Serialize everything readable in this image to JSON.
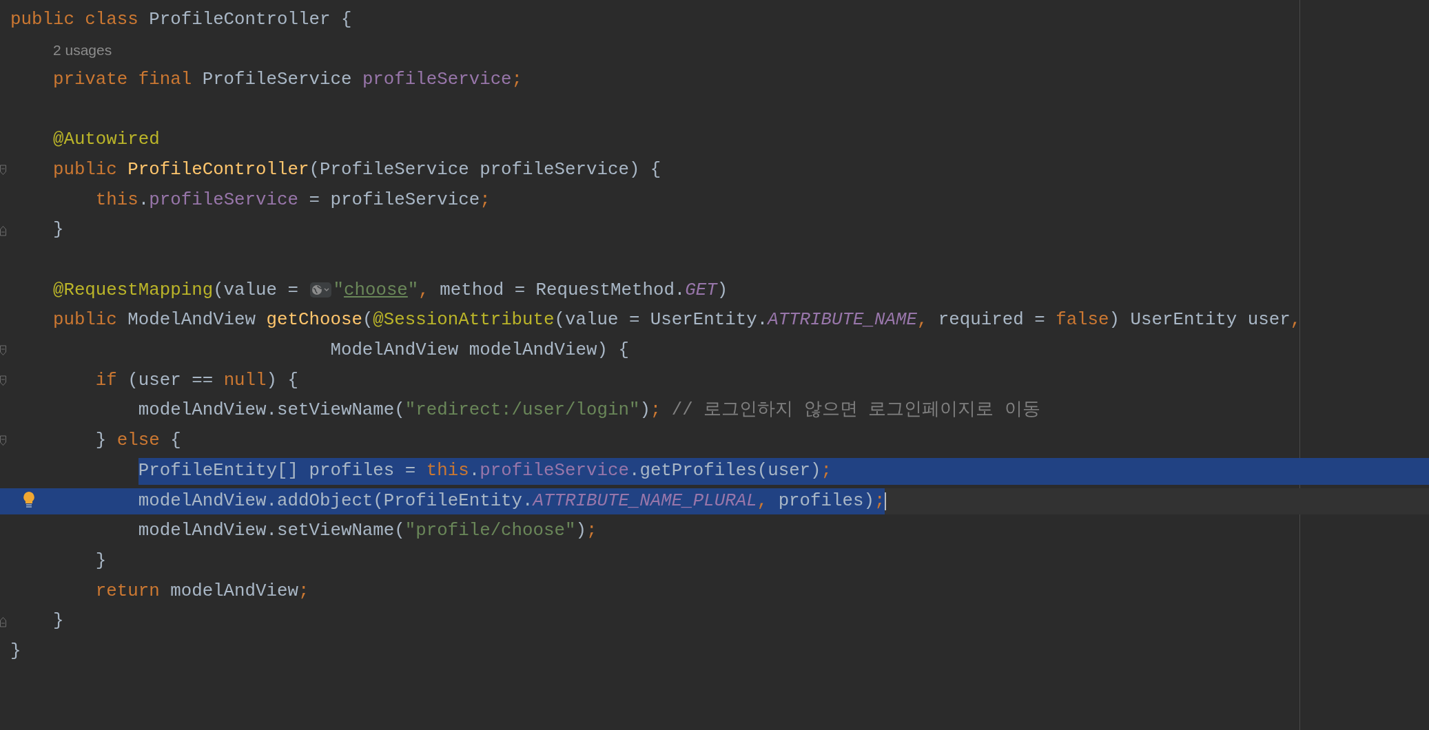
{
  "editor": {
    "lines": [
      {
        "kind": "code",
        "fold_start": false,
        "fold_end": false,
        "selected": false,
        "caret": false,
        "bulb": false,
        "tokens": [
          {
            "kind": "kw",
            "text": "public class "
          },
          {
            "kind": "plain",
            "text": "ProfileController {"
          }
        ]
      },
      {
        "kind": "hint",
        "text": "2 usages"
      },
      {
        "kind": "code",
        "fold_start": false,
        "fold_end": false,
        "selected": false,
        "caret": false,
        "bulb": false,
        "tokens": [
          {
            "kind": "kw",
            "text": "    private final "
          },
          {
            "kind": "plain",
            "text": "ProfileService "
          },
          {
            "kind": "field",
            "text": "profileService"
          },
          {
            "kind": "kw",
            "text": ";"
          }
        ]
      },
      {
        "kind": "blank"
      },
      {
        "kind": "code",
        "fold_start": false,
        "fold_end": false,
        "selected": false,
        "caret": false,
        "bulb": false,
        "tokens": [
          {
            "kind": "ann",
            "text": "    @Autowired"
          }
        ]
      },
      {
        "kind": "code",
        "fold_start": true,
        "fold_end": false,
        "selected": false,
        "caret": false,
        "bulb": false,
        "tokens": [
          {
            "kind": "kw",
            "text": "    public "
          },
          {
            "kind": "decl",
            "text": "ProfileController"
          },
          {
            "kind": "plain",
            "text": "(ProfileService profileService) {"
          }
        ]
      },
      {
        "kind": "code",
        "fold_start": false,
        "fold_end": false,
        "selected": false,
        "caret": false,
        "bulb": false,
        "tokens": [
          {
            "kind": "kw",
            "text": "        this"
          },
          {
            "kind": "plain",
            "text": "."
          },
          {
            "kind": "field",
            "text": "profileService"
          },
          {
            "kind": "plain",
            "text": " = profileService"
          },
          {
            "kind": "kw",
            "text": ";"
          }
        ]
      },
      {
        "kind": "code",
        "fold_start": false,
        "fold_end": true,
        "selected": false,
        "caret": false,
        "bulb": false,
        "tokens": [
          {
            "kind": "plain",
            "text": "    }"
          }
        ]
      },
      {
        "kind": "blank"
      },
      {
        "kind": "code",
        "fold_start": false,
        "fold_end": false,
        "selected": false,
        "caret": false,
        "bulb": false,
        "tokens": [
          {
            "kind": "ann",
            "text": "    @RequestMapping"
          },
          {
            "kind": "plain",
            "text": "(value = "
          },
          {
            "kind": "inlay"
          },
          {
            "kind": "str",
            "text": "\""
          },
          {
            "kind": "url",
            "text": "choose"
          },
          {
            "kind": "str",
            "text": "\""
          },
          {
            "kind": "kw",
            "text": ", "
          },
          {
            "kind": "plain",
            "text": "method = RequestMethod."
          },
          {
            "kind": "const",
            "text": "GET"
          },
          {
            "kind": "plain",
            "text": ")"
          }
        ]
      },
      {
        "kind": "code",
        "fold_start": false,
        "fold_end": false,
        "selected": false,
        "caret": false,
        "bulb": false,
        "tokens": [
          {
            "kind": "kw",
            "text": "    public "
          },
          {
            "kind": "plain",
            "text": "ModelAndView "
          },
          {
            "kind": "decl",
            "text": "getChoose"
          },
          {
            "kind": "plain",
            "text": "("
          },
          {
            "kind": "ann",
            "text": "@SessionAttribute"
          },
          {
            "kind": "plain",
            "text": "(value = UserEntity."
          },
          {
            "kind": "const",
            "text": "ATTRIBUTE_NAME"
          },
          {
            "kind": "kw",
            "text": ", "
          },
          {
            "kind": "plain",
            "text": "required = "
          },
          {
            "kind": "kw",
            "text": "false"
          },
          {
            "kind": "plain",
            "text": ") UserEntity user"
          },
          {
            "kind": "kw",
            "text": ","
          }
        ]
      },
      {
        "kind": "code",
        "fold_start": true,
        "fold_end": false,
        "selected": false,
        "caret": false,
        "bulb": false,
        "tokens": [
          {
            "kind": "plain",
            "text": "                              ModelAndView modelAndView) {"
          }
        ]
      },
      {
        "kind": "code",
        "fold_start": true,
        "fold_end": false,
        "selected": false,
        "caret": false,
        "bulb": false,
        "tokens": [
          {
            "kind": "kw",
            "text": "        if "
          },
          {
            "kind": "plain",
            "text": "(user == "
          },
          {
            "kind": "kw",
            "text": "null"
          },
          {
            "kind": "plain",
            "text": ") {"
          }
        ]
      },
      {
        "kind": "code",
        "fold_start": false,
        "fold_end": false,
        "selected": false,
        "caret": false,
        "bulb": false,
        "tokens": [
          {
            "kind": "plain",
            "text": "            modelAndView.setViewName("
          },
          {
            "kind": "str",
            "text": "\"redirect:/user/login\""
          },
          {
            "kind": "plain",
            "text": ")"
          },
          {
            "kind": "kw",
            "text": "; "
          },
          {
            "kind": "comment",
            "text": "// 로그인하지 않으면 로그인페이지로 이동"
          }
        ]
      },
      {
        "kind": "code",
        "fold_start": true,
        "fold_end": false,
        "selected": false,
        "caret": false,
        "bulb": false,
        "tokens": [
          {
            "kind": "plain",
            "text": "        } "
          },
          {
            "kind": "kw",
            "text": "else "
          },
          {
            "kind": "plain",
            "text": "{"
          }
        ]
      },
      {
        "kind": "code",
        "fold_start": false,
        "fold_end": false,
        "selected": true,
        "caret": false,
        "bulb": false,
        "tokens": [
          {
            "kind": "plain",
            "text": "            ProfileEntity[] profiles = "
          },
          {
            "kind": "kw",
            "text": "this"
          },
          {
            "kind": "plain",
            "text": "."
          },
          {
            "kind": "field",
            "text": "profileService"
          },
          {
            "kind": "plain",
            "text": ".getProfiles(user)"
          },
          {
            "kind": "kw",
            "text": ";"
          }
        ]
      },
      {
        "kind": "code",
        "fold_start": false,
        "fold_end": false,
        "selected": true,
        "caret": true,
        "bulb": true,
        "tokens": [
          {
            "kind": "plain",
            "text": "            modelAndView.addObject(ProfileEntity."
          },
          {
            "kind": "const",
            "text": "ATTRIBUTE_NAME_PLURAL"
          },
          {
            "kind": "kw",
            "text": ", "
          },
          {
            "kind": "plain",
            "text": "profiles)"
          },
          {
            "kind": "kw",
            "text": ";"
          }
        ]
      },
      {
        "kind": "code",
        "fold_start": false,
        "fold_end": false,
        "selected": false,
        "caret": false,
        "bulb": false,
        "tokens": [
          {
            "kind": "plain",
            "text": "            modelAndView.setViewName("
          },
          {
            "kind": "str",
            "text": "\"profile/choose\""
          },
          {
            "kind": "plain",
            "text": ")"
          },
          {
            "kind": "kw",
            "text": ";"
          }
        ]
      },
      {
        "kind": "code",
        "fold_start": false,
        "fold_end": false,
        "selected": false,
        "caret": false,
        "bulb": false,
        "tokens": [
          {
            "kind": "plain",
            "text": "        }"
          }
        ]
      },
      {
        "kind": "code",
        "fold_start": false,
        "fold_end": false,
        "selected": false,
        "caret": false,
        "bulb": false,
        "tokens": [
          {
            "kind": "kw",
            "text": "        return "
          },
          {
            "kind": "plain",
            "text": "modelAndView"
          },
          {
            "kind": "kw",
            "text": ";"
          }
        ]
      },
      {
        "kind": "code",
        "fold_start": false,
        "fold_end": true,
        "selected": false,
        "caret": false,
        "bulb": false,
        "tokens": [
          {
            "kind": "plain",
            "text": "    }"
          }
        ]
      },
      {
        "kind": "code",
        "fold_start": false,
        "fold_end": false,
        "selected": false,
        "caret": false,
        "bulb": false,
        "tokens": [
          {
            "kind": "plain",
            "text": "}"
          }
        ]
      }
    ]
  }
}
